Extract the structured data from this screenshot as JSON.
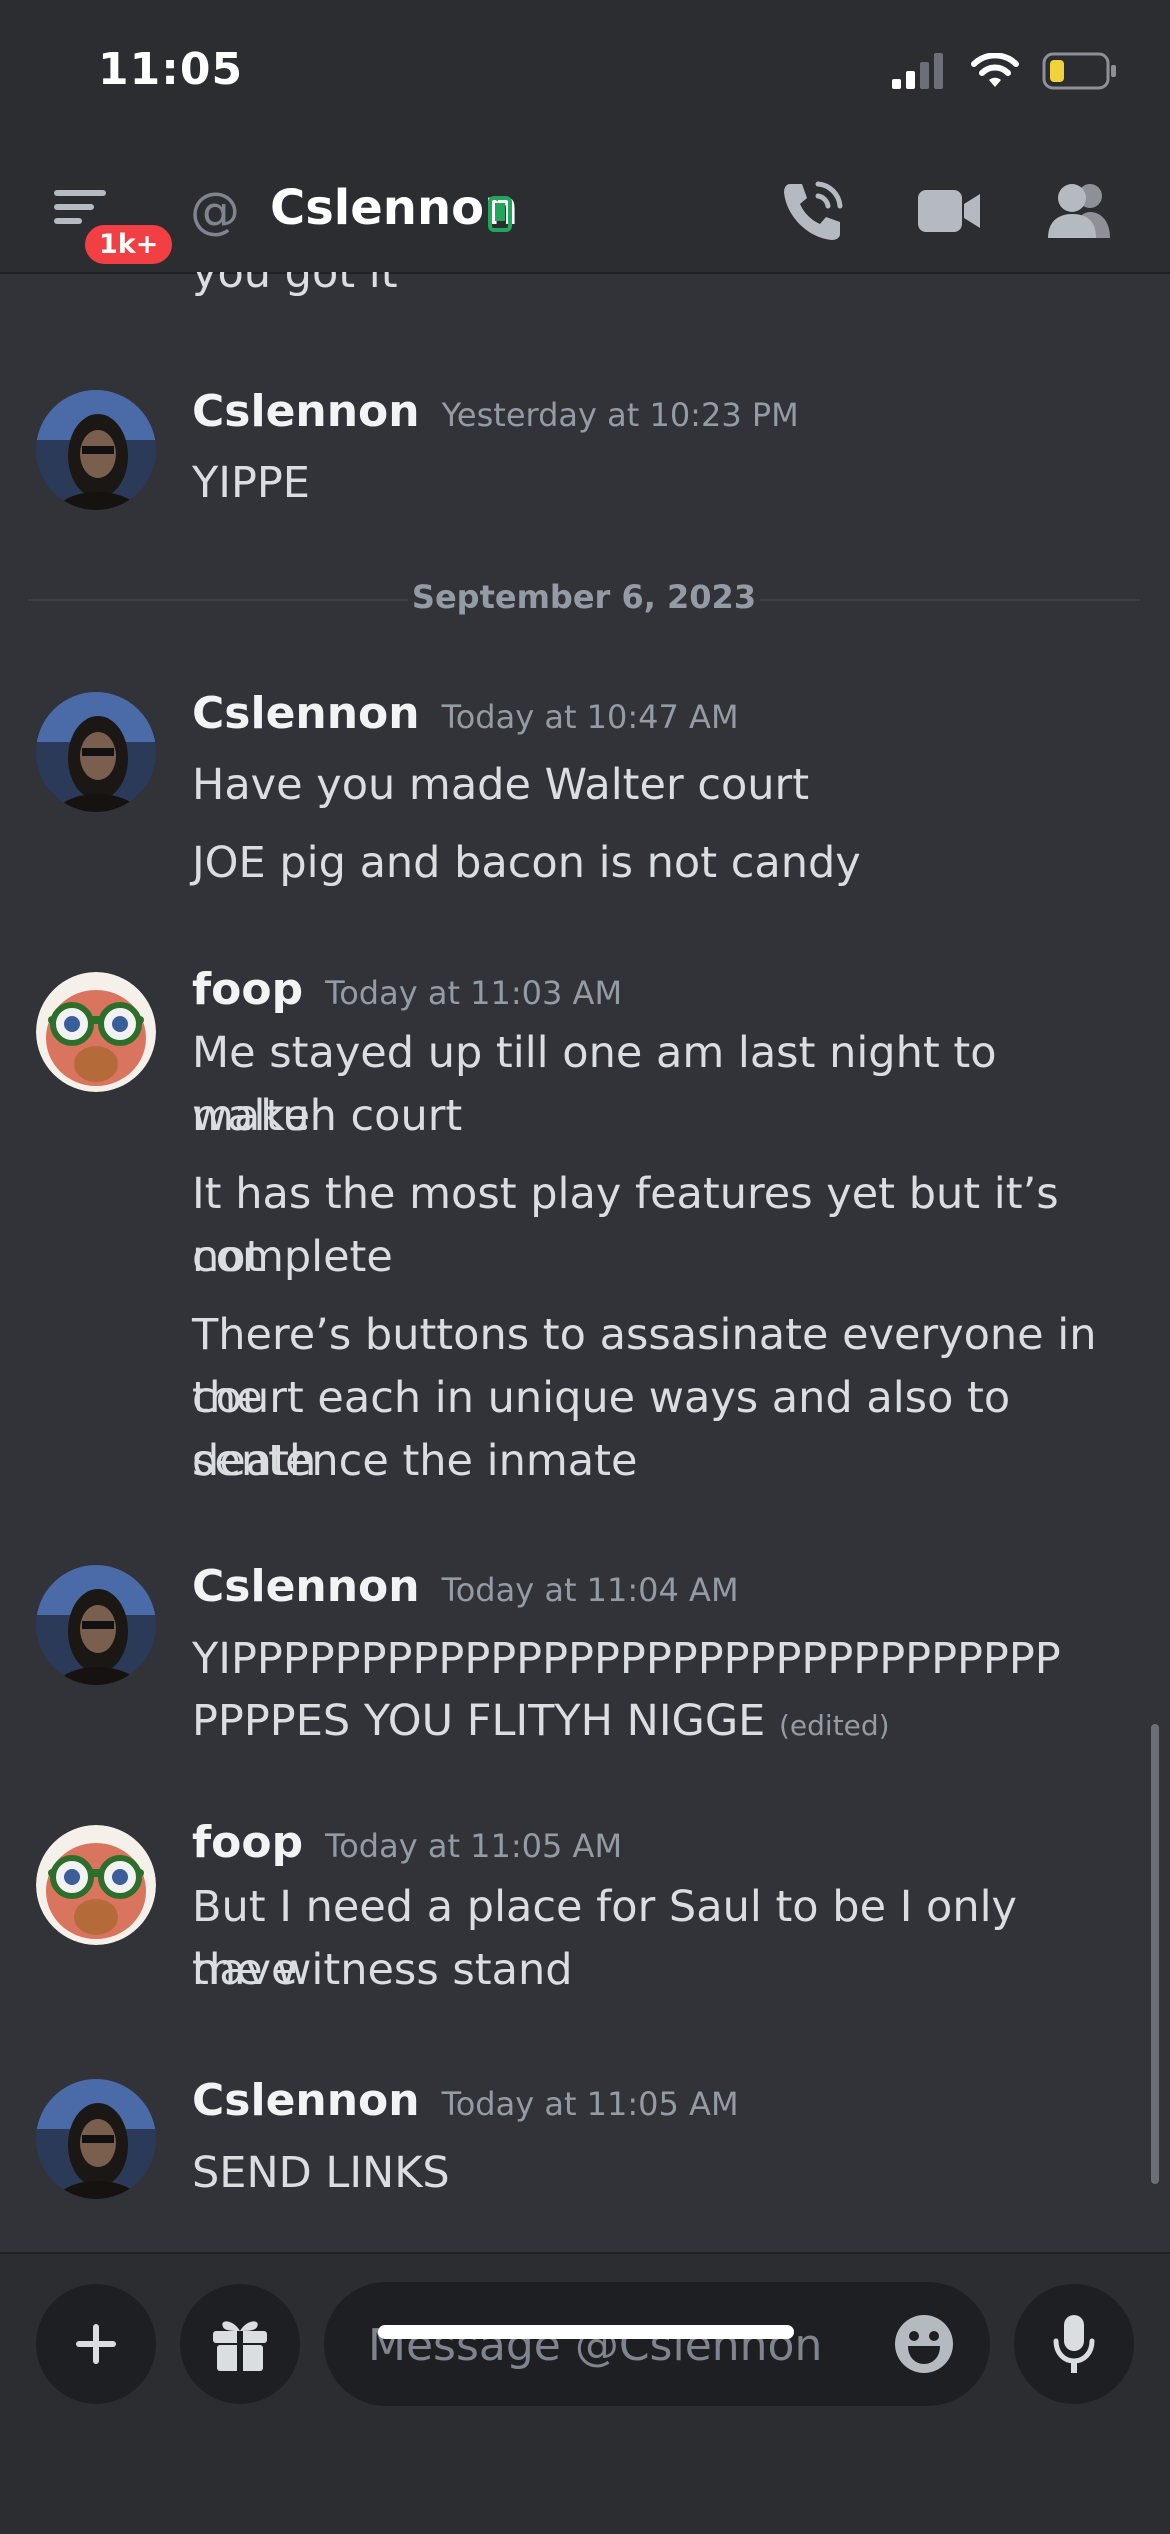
{
  "status_bar": {
    "time": "11:05"
  },
  "header": {
    "badge": "1k+",
    "title": "Cslennon"
  },
  "messages": {
    "partial_line": "you got it",
    "m1": {
      "author": "Cslennon",
      "timestamp": "Yesterday at 10:23 PM",
      "lines": [
        "YIPPE"
      ]
    },
    "divider": "September 6, 2023",
    "m2": {
      "author": "Cslennon",
      "timestamp": "Today at 10:47 AM",
      "lines": [
        "Have you made Walter court",
        "JOE pig and bacon is not candy"
      ]
    },
    "m3": {
      "author": "foop",
      "timestamp": "Today at 11:03 AM",
      "lines": [
        "Me stayed up till one am last night to make",
        "waltuh court",
        "It has the most play features yet but it’s not",
        "complete",
        "There’s buttons to assasinate everyone in the",
        "court each in unique ways and also to death",
        "sentence the inmate"
      ]
    },
    "m4": {
      "author": "Cslennon",
      "timestamp": "Today at 11:04 AM",
      "lines": [
        "YIPPPPPPPPPPPPPPPPPPPPPPPPPPPPPPPP",
        "PPPPES YOU FLITYH NIGGE"
      ],
      "edited": "(edited)"
    },
    "m5": {
      "author": "foop",
      "timestamp": "Today at 11:05 AM",
      "lines": [
        "But I need a place for Saul to be I only have",
        "the witness stand"
      ]
    },
    "m6": {
      "author": "Cslennon",
      "timestamp": "Today at 11:05 AM",
      "lines": [
        "SEND LINKS"
      ]
    }
  },
  "composer": {
    "placeholder": "Message @Cslennon"
  },
  "colors": {
    "background": "#313338",
    "bars": "#2b2d31",
    "badge": "#f23f43",
    "online_mobile": "#23a55a"
  },
  "icons": [
    "menu-icon",
    "at-icon",
    "mobile-status-icon",
    "call-icon",
    "video-icon",
    "members-icon",
    "plus-icon",
    "gift-icon",
    "emoji-icon",
    "mic-icon"
  ]
}
